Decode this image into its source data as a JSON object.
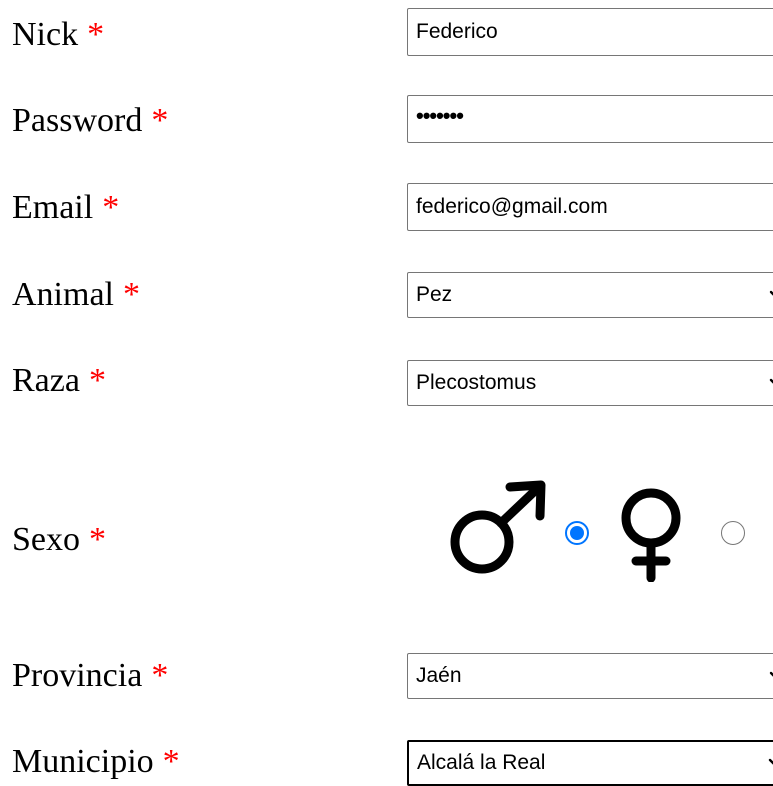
{
  "form": {
    "required_marker": "*",
    "nick": {
      "label": "Nick",
      "value": "Federico"
    },
    "password": {
      "label": "Password",
      "value": "•••••••"
    },
    "email": {
      "label": "Email",
      "value": "federico@gmail.com"
    },
    "animal": {
      "label": "Animal",
      "selected": "Pez"
    },
    "raza": {
      "label": "Raza",
      "selected": "Plecostomus"
    },
    "sexo": {
      "label": "Sexo",
      "options": [
        {
          "icon": "male-symbol-icon",
          "checked": true
        },
        {
          "icon": "female-symbol-icon",
          "checked": false
        }
      ]
    },
    "provincia": {
      "label": "Provincia",
      "selected": "Jaén"
    },
    "municipio": {
      "label": "Municipio",
      "selected": "Alcalá la Real"
    }
  },
  "colors": {
    "required": "#ff0000",
    "radio_accent": "#0075ff",
    "field_border": "#767676"
  }
}
